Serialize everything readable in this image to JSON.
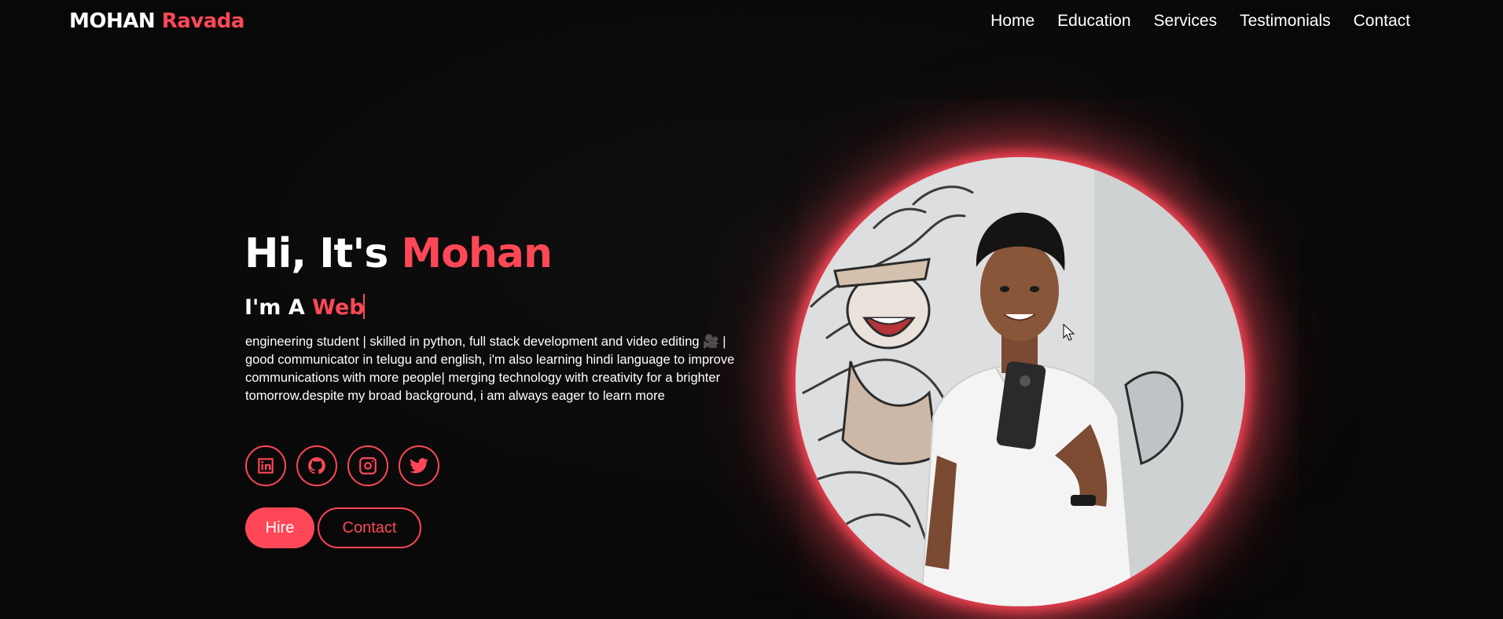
{
  "header": {
    "logo_first": "MOHAN",
    "logo_second": "Ravada",
    "nav": [
      "Home",
      "Education",
      "Services",
      "Testimonials",
      "Contact"
    ]
  },
  "hero": {
    "greeting": "Hi, It's",
    "name": "Mohan",
    "sub_prefix": "I'm A",
    "sub_typed": "Web",
    "bio": "engineering student | skilled in python, full stack development and video editing 🎥 | good communicator in telugu and english, i'm also learning hindi language to improve communications with more people| merging technology with creativity for a brighter tomorrow.despite my broad background, i am always eager to learn more"
  },
  "socials": [
    {
      "name": "linkedin-icon"
    },
    {
      "name": "github-icon"
    },
    {
      "name": "instagram-icon"
    },
    {
      "name": "twitter-icon"
    }
  ],
  "buttons": {
    "hire": "Hire",
    "contact": "Contact"
  },
  "colors": {
    "accent": "#ff4757",
    "background": "#080808",
    "text": "#ffffff"
  },
  "photo": {
    "description_icon": "profile-photo"
  }
}
